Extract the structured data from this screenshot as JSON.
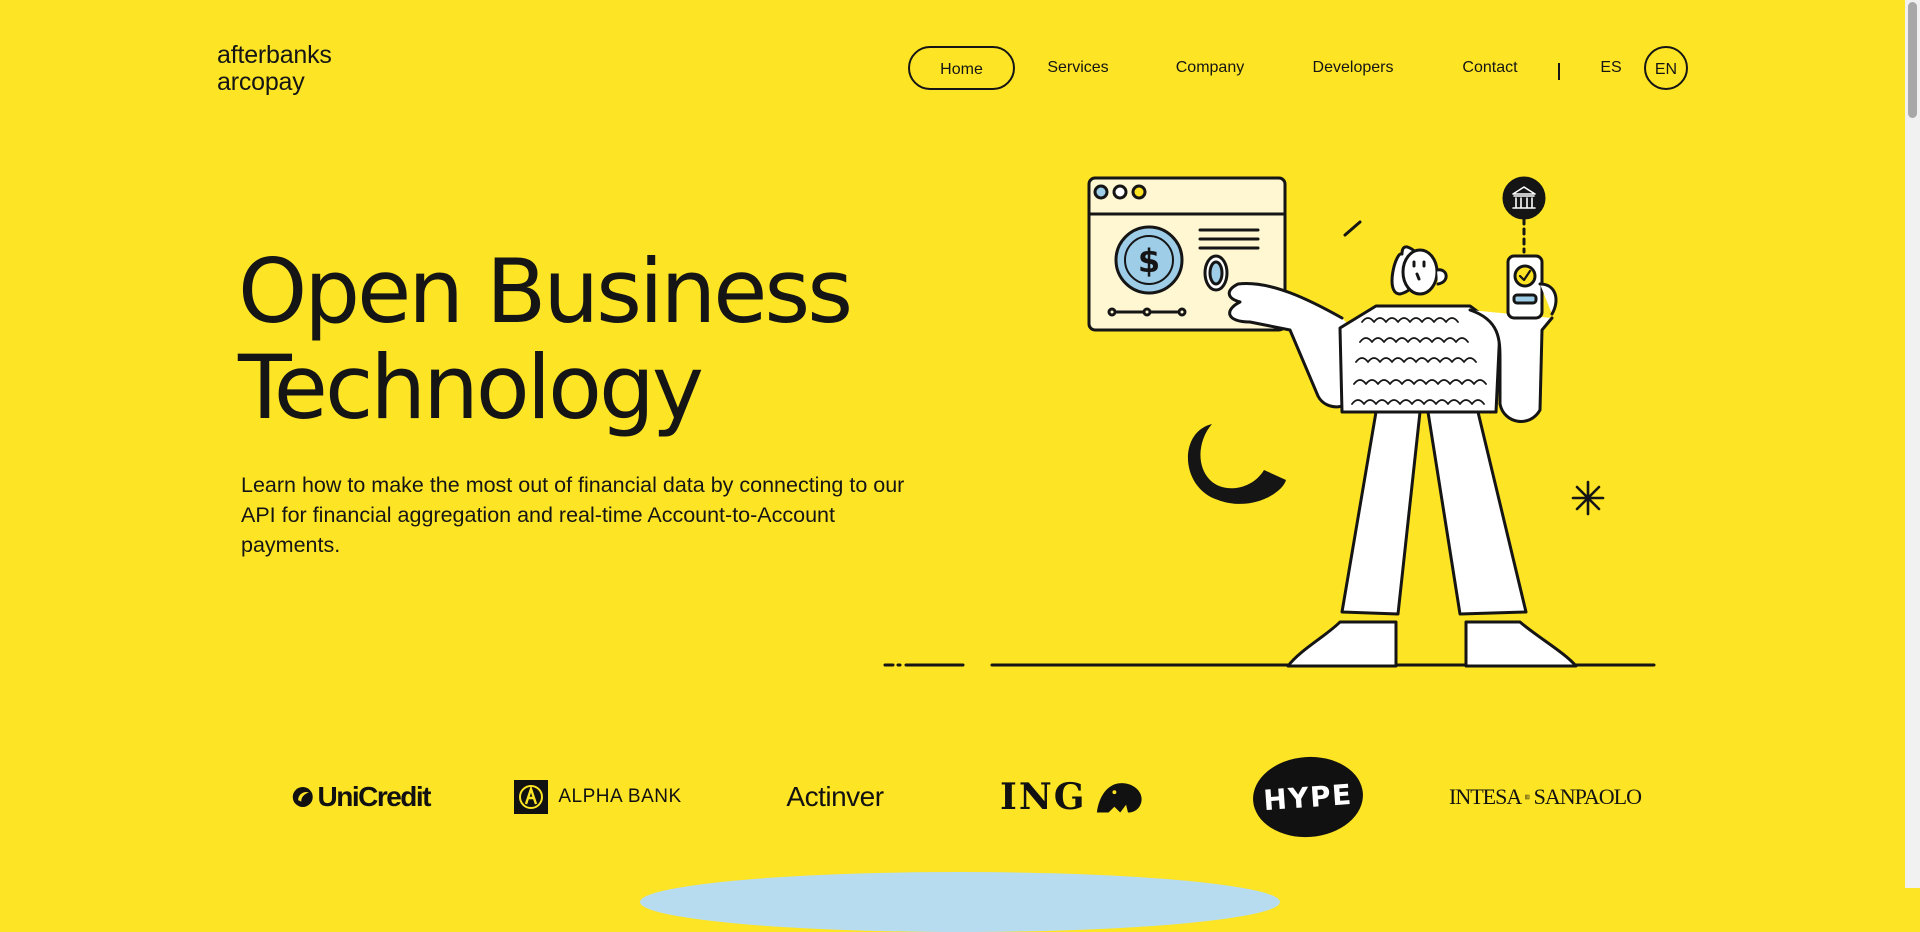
{
  "brand": {
    "line1": "afterbanks",
    "line2": "arcopay"
  },
  "nav": {
    "items": [
      {
        "label": "Home",
        "active": true
      },
      {
        "label": "Services",
        "active": false
      },
      {
        "label": "Company",
        "active": false
      },
      {
        "label": "Developers",
        "active": false
      },
      {
        "label": "Contact",
        "active": false
      }
    ],
    "languages": [
      {
        "label": "ES",
        "active": false
      },
      {
        "label": "EN",
        "active": true
      }
    ]
  },
  "hero": {
    "title_line1": "Open Business",
    "title_line2": "Technology",
    "subtitle": "Learn how to make the most out of financial data by connecting to our API for financial aggregation and real-time Account-to-Account payments."
  },
  "illustration": {
    "dollar_symbol": "$",
    "check_symbol": "✓",
    "colors": {
      "panel": "#fff7d2",
      "coin": "#9ecde8",
      "accent": "#fde425"
    }
  },
  "partners": [
    {
      "name": "UniCredit"
    },
    {
      "name": "ALPHA BANK"
    },
    {
      "name": "Actinver"
    },
    {
      "name": "ING"
    },
    {
      "name": "HYPE"
    },
    {
      "name_left": "INTESA",
      "name_right": "SANPAOLO"
    }
  ],
  "theme": {
    "background": "#fde425",
    "text": "#151515",
    "arc": "#b8dcef"
  }
}
